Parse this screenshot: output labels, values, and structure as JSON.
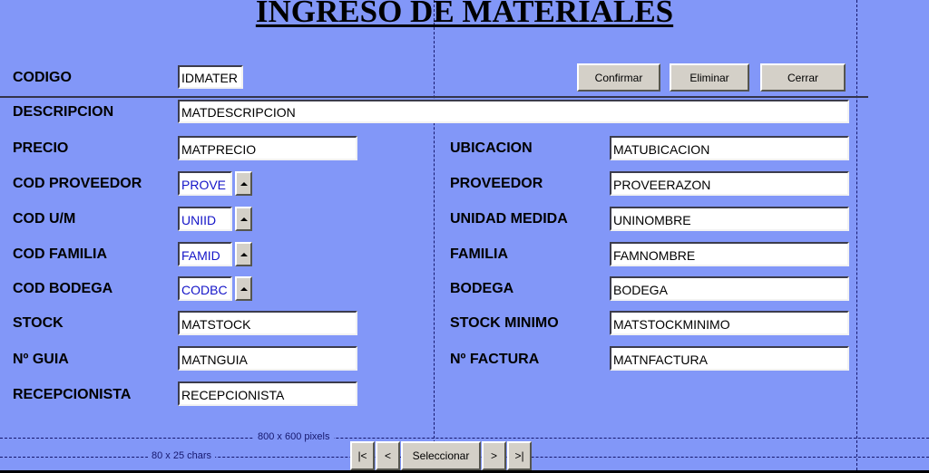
{
  "window": {
    "title": "INGRESO DE MATERIALES",
    "background_color": "#8297f8",
    "button_face_color": "#d4d0c8",
    "guide_color": "#16186e",
    "field_text_color": "#000000",
    "spinner_text_color": "#1414c8"
  },
  "toolbar": {
    "confirm_label": "Confirmar",
    "delete_label": "Eliminar",
    "close_label": "Cerrar"
  },
  "form": {
    "left_column": [
      {
        "label": "CODIGO",
        "value": "IDMATER",
        "type": "text",
        "name": "codigo"
      },
      {
        "label": "DESCRIPCION",
        "value": "MATDESCRIPCION",
        "type": "text",
        "name": "descripcion"
      },
      {
        "label": "PRECIO",
        "value": "MATPRECIO",
        "type": "text",
        "name": "precio"
      },
      {
        "label": "COD PROVEEDOR",
        "value": "PROVE",
        "type": "spinner",
        "name": "cod-proveedor"
      },
      {
        "label": "COD U/M",
        "value": "UNIID",
        "type": "spinner",
        "name": "cod-um"
      },
      {
        "label": "COD FAMILIA",
        "value": "FAMID",
        "type": "spinner",
        "name": "cod-familia"
      },
      {
        "label": "COD BODEGA",
        "value": "CODBC",
        "type": "spinner",
        "name": "cod-bodega"
      },
      {
        "label": "STOCK",
        "value": "MATSTOCK",
        "type": "text",
        "name": "stock"
      },
      {
        "label": "Nº GUIA",
        "value": "MATNGUIA",
        "type": "text",
        "name": "n-guia"
      },
      {
        "label": "RECEPCIONISTA",
        "value": "RECEPCIONISTA",
        "type": "text",
        "name": "recepcionista"
      }
    ],
    "right_column": [
      {
        "label": "UBICACION",
        "value": "MATUBICACION",
        "type": "text",
        "name": "ubicacion"
      },
      {
        "label": "PROVEEDOR",
        "value": "PROVEERAZON",
        "type": "text",
        "name": "proveedor"
      },
      {
        "label": "UNIDAD MEDIDA",
        "value": "UNINOMBRE",
        "type": "text",
        "name": "unidad-medida"
      },
      {
        "label": "FAMILIA",
        "value": "FAMNOMBRE",
        "type": "text",
        "name": "familia"
      },
      {
        "label": "BODEGA",
        "value": "BODEGA",
        "type": "text",
        "name": "bodega"
      },
      {
        "label": "STOCK MINIMO",
        "value": "MATSTOCKMINIMO",
        "type": "text",
        "name": "stock-minimo"
      },
      {
        "label": "Nº FACTURA",
        "value": "MATNFACTURA",
        "type": "text",
        "name": "n-factura"
      }
    ]
  },
  "navigator": {
    "first_label": "|<",
    "prev_label": "<",
    "select_label": "Seleccionar",
    "next_label": ">",
    "last_label": ">|"
  },
  "guides": {
    "pixels_label": "800 x 600 pixels",
    "chars_label": "80 x 25 chars"
  }
}
